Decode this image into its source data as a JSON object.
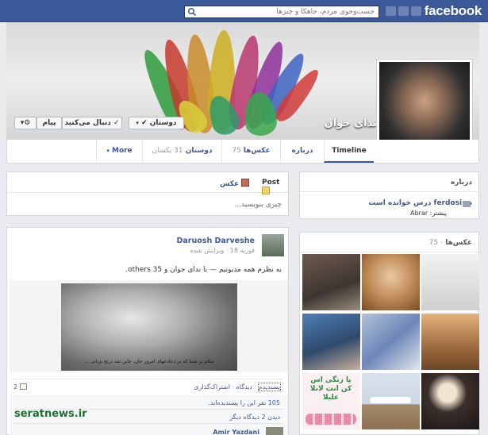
{
  "header": {
    "logo": "facebook",
    "search_placeholder": "جست‌وجوی مردم، جاهکا و چیزها"
  },
  "profile": {
    "name": "ندای جوان",
    "buttons": {
      "message": "پیام",
      "following": "دنبال می‌کنید",
      "friends": "دوستان"
    }
  },
  "nav": {
    "timeline": "Timeline",
    "about": "درباره",
    "photos": "عکس‌ها",
    "photos_count": "75",
    "friends": "دوستان",
    "friends_count": "31 یکسان",
    "more": "More"
  },
  "composer": {
    "post_tab": "Post",
    "photo_tab": "عکس",
    "placeholder": "چیزی بنویسید..."
  },
  "about_box": {
    "title": "درباره",
    "study_text": "در ferdosi درس خوانده است",
    "past": "پیشتر: Abrar"
  },
  "photos_box": {
    "title": "عکس‌ها",
    "count": "75",
    "poster_caption": "یا زنگی اس کن انت لانلا علیلا"
  },
  "post": {
    "author": "Daruosh Darveshe",
    "meta": "فوریه 18 · ویرایش شده",
    "text": "به نظرم همه مدیونیم — با ندای جوان و 35 others.",
    "image_caption": "سلام بر شما که در دعادعهای امروز جان، خاین شد درنج بزبانی ...",
    "actions": {
      "like": "پسندیدم",
      "comment": "دیدگاه",
      "share": "اشتراک‌گذاری"
    },
    "share_count": "2",
    "likes_text": "105 نفر این را پسندیده‌اند.",
    "more_comments": "دیدن 2 دیدگاه دیگر",
    "commenter": "Amir Yazdani"
  },
  "watermark": "seratnews.ir"
}
